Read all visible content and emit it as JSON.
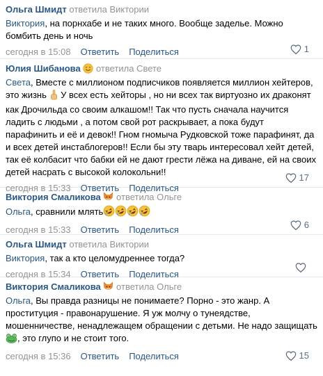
{
  "comments": [
    {
      "author": "Ольга Шмидт",
      "replied": "ответила Виктории",
      "mention": "Виктория",
      "text": ", на порнхабе и не таких много. Вообще заделье. Можно бомбить день и ночь",
      "time": "сегодня в 15:08",
      "reply": "Ответить",
      "share": "Поделиться",
      "likes": "1"
    },
    {
      "author": "Юлия Шибанова",
      "replied": "ответила Свете",
      "mention": "Света",
      "text_before_hand": ", Вместе с миллионом подписчиков появляется миллион хейтеров, это жизнь",
      "text_after_hand": "У всех есть хейторы , но ни всех так виртуозно их драконят как Дрочильда со своим алкашом!! Так что пусть сначала научится ладить с людьми , а потом свой рот раскрывает, а пока будут парафинить и её и девок!! Гном гномыча Рудковской тоже парафинят, да и всех детей инстаблогеров!! Если бы эту тварь интересовал хейт детей, так её колбасит что бабки ей не дают грести лёжа на диване, ей на своих детей насрать с высокой колокольни!!",
      "time": "сегодня в 15:33",
      "reply": "Ответить",
      "share": "Поделиться",
      "likes": "17"
    },
    {
      "author": "Виктория Смаликова",
      "replied": "ответила Ольге",
      "mention": "Ольга",
      "text": ", сравнили млять",
      "time": "сегодня в 15:33",
      "reply": "Ответить",
      "share": "Поделиться",
      "likes": "6"
    },
    {
      "author": "Ольга Шмидт",
      "replied": "ответила Виктории",
      "mention": "Виктория",
      "text": ", так а кто целомудреннее тогда?",
      "time": "сегодня в 15:34",
      "reply": "Ответить",
      "share": "Поделиться"
    },
    {
      "author": "Виктория Смаликова",
      "replied": "ответила Ольге",
      "mention": "Ольга",
      "text_before_frog": ", Вы правда разницы не понимаете? Порно - это жанр. А проституция - правонарушение. Я уж молчу о тунеядстве, мошенничестве, ненадлежащем обращении с детьми. Не надо защищать",
      "text_after_frog": ", это глупо и не стоит того.",
      "time": "сегодня в 15:36",
      "reply": "Ответить",
      "share": "Поделиться",
      "likes": "15"
    }
  ]
}
